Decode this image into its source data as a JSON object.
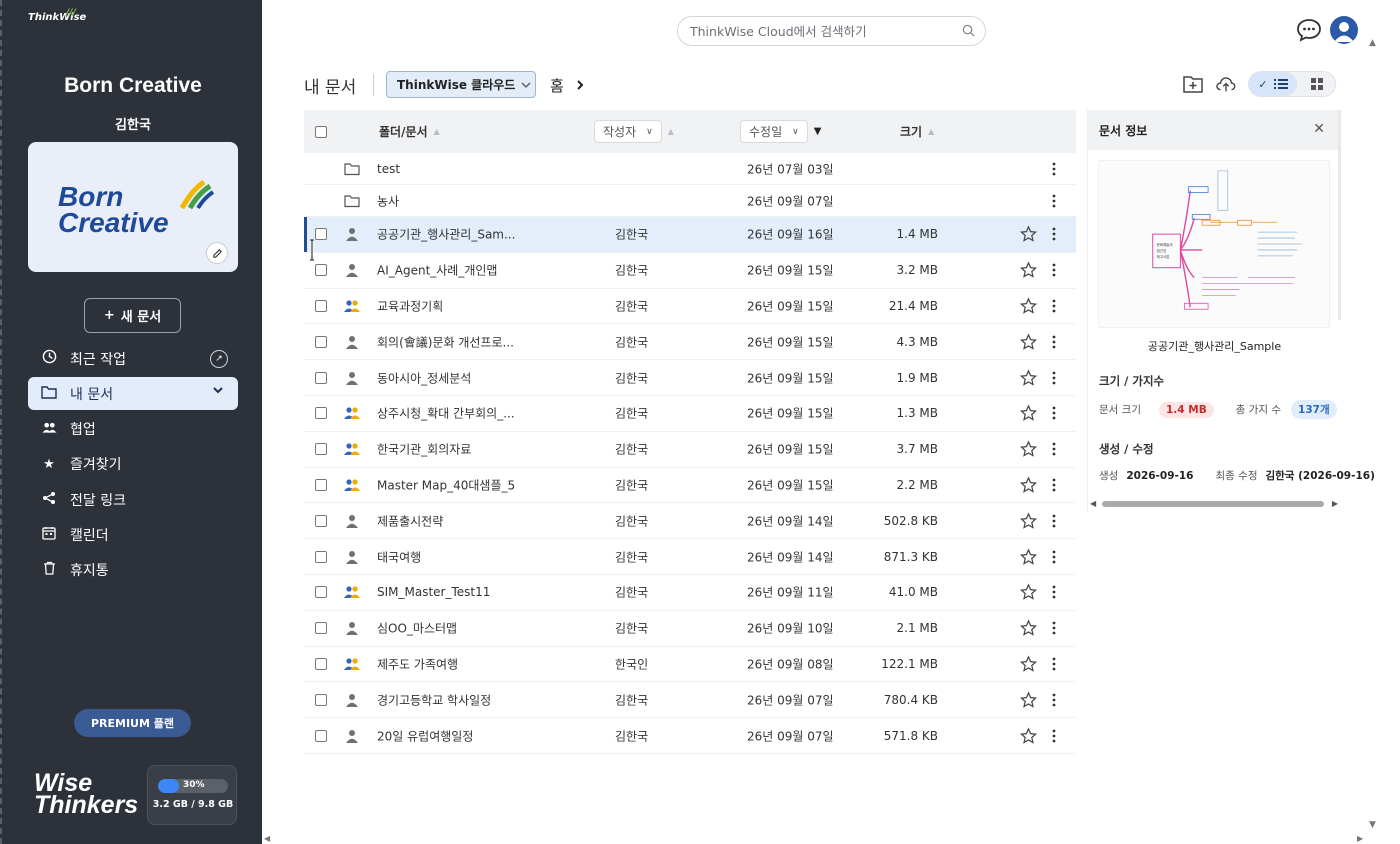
{
  "app": {
    "logo_text": "ThinkWise",
    "brand_footer": "Wise Thinkers"
  },
  "sidebar": {
    "workspace_title": "Born Creative",
    "user_name": "김한국",
    "card_brand_line1": "Born",
    "card_brand_line2": "Creative",
    "new_doc_label": "새 문서",
    "items": [
      {
        "label": "최근 작업",
        "icon": "clock-icon"
      },
      {
        "label": "내 문서",
        "icon": "folder-icon"
      },
      {
        "label": "협업",
        "icon": "people-icon"
      },
      {
        "label": "즐겨찾기",
        "icon": "star-icon"
      },
      {
        "label": "전달 링크",
        "icon": "share-icon"
      },
      {
        "label": "캘린더",
        "icon": "calendar-icon"
      },
      {
        "label": "휴지통",
        "icon": "trash-icon"
      }
    ],
    "premium_label": "PREMIUM 플랜",
    "storage": {
      "percent_label": "30%",
      "percent": 30,
      "usage": "3.2 GB / 9.8 GB"
    }
  },
  "topbar": {
    "search_placeholder": "ThinkWise Cloud에서 검색하기"
  },
  "toolbar": {
    "page_title": "내 문서",
    "cloud_label": "ThinkWise 클라우드",
    "breadcrumb": "홈"
  },
  "table": {
    "headers": {
      "name": "폴더/문서",
      "author": "작성자",
      "modified": "수정일",
      "size": "크기"
    },
    "folders": [
      {
        "name": "test",
        "date": "26년 07월 03일"
      },
      {
        "name": "농사",
        "date": "26년 09월 07일"
      }
    ],
    "rows": [
      {
        "name": "공공기관_행사관리_Sam...",
        "author": "김한국",
        "date": "26년 09월 16일",
        "size": "1.4 MB",
        "shared": false
      },
      {
        "name": "AI_Agent_사례_개인맵",
        "author": "김한국",
        "date": "26년 09월 15일",
        "size": "3.2 MB",
        "shared": false
      },
      {
        "name": "교육과정기획",
        "author": "김한국",
        "date": "26년 09월 15일",
        "size": "21.4 MB",
        "shared": true
      },
      {
        "name": "회의(會議)문화 개선프로...",
        "author": "김한국",
        "date": "26년 09월 15일",
        "size": "4.3 MB",
        "shared": false
      },
      {
        "name": "동아시아_정세분석",
        "author": "김한국",
        "date": "26년 09월 15일",
        "size": "1.9 MB",
        "shared": false
      },
      {
        "name": "상주시청_확대 간부회의_...",
        "author": "김한국",
        "date": "26년 09월 15일",
        "size": "1.3 MB",
        "shared": true
      },
      {
        "name": "한국기관_회의자료",
        "author": "김한국",
        "date": "26년 09월 15일",
        "size": "3.7 MB",
        "shared": true
      },
      {
        "name": "Master Map_40대샘플_5",
        "author": "김한국",
        "date": "26년 09월 15일",
        "size": "2.2 MB",
        "shared": true
      },
      {
        "name": "제품출시전략",
        "author": "김한국",
        "date": "26년 09월 14일",
        "size": "502.8 KB",
        "shared": false
      },
      {
        "name": "태국여행",
        "author": "김한국",
        "date": "26년 09월 14일",
        "size": "871.3 KB",
        "shared": false
      },
      {
        "name": "SIM_Master_Test11",
        "author": "김한국",
        "date": "26년 09월 11일",
        "size": "41.0 MB",
        "shared": true
      },
      {
        "name": "심OO_마스터맵",
        "author": "김한국",
        "date": "26년 09월 10일",
        "size": "2.1 MB",
        "shared": false
      },
      {
        "name": "제주도 가족여행",
        "author": "한국인",
        "date": "26년 09월 08일",
        "size": "122.1 MB",
        "shared": true
      },
      {
        "name": "경기고등학교 학사일정",
        "author": "김한국",
        "date": "26년 09월 07일",
        "size": "780.4 KB",
        "shared": false
      },
      {
        "name": "20일 유럽여행일정",
        "author": "김한국",
        "date": "26년 09월 07일",
        "size": "571.8 KB",
        "shared": false
      }
    ]
  },
  "info_panel": {
    "title": "문서 정보",
    "doc_name": "공공기관_행사관리_Sample",
    "size_section": "크기 / 가지수",
    "size_label": "문서 크기",
    "size_value": "1.4 MB",
    "branch_label": "총 가지 수",
    "branch_value": "137개",
    "history_section": "생성 / 수정",
    "created_label": "생성",
    "created_value": "2026-09-16",
    "modified_label": "최종 수정",
    "modified_value": "김한국 (2026-09-16)"
  },
  "colors": {
    "sidebar_bg": "#2d3139",
    "accent": "#1f4e95",
    "selected_row": "#e3eefa",
    "shared_icon": "#f2a900"
  }
}
